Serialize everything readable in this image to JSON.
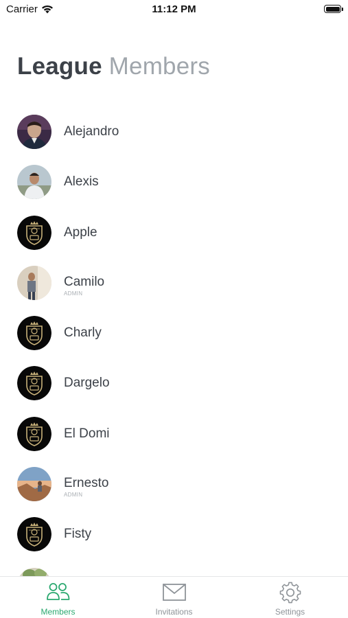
{
  "status_bar": {
    "carrier": "Carrier",
    "time": "11:12 PM"
  },
  "header": {
    "title_strong": "League",
    "title_light": "Members"
  },
  "members": [
    {
      "name": "Alejandro",
      "role": "",
      "avatar": "photo-portrait-dark"
    },
    {
      "name": "Alexis",
      "role": "",
      "avatar": "photo-outdoor"
    },
    {
      "name": "Apple",
      "role": "",
      "avatar": "league-crest-badge"
    },
    {
      "name": "Camilo",
      "role": "ADMIN",
      "avatar": "photo-indoor"
    },
    {
      "name": "Charly",
      "role": "",
      "avatar": "league-crest-badge"
    },
    {
      "name": "Dargelo",
      "role": "",
      "avatar": "league-crest-badge"
    },
    {
      "name": "El Domi",
      "role": "",
      "avatar": "league-crest-badge"
    },
    {
      "name": "Ernesto",
      "role": "ADMIN",
      "avatar": "photo-sunset"
    },
    {
      "name": "Fisty",
      "role": "",
      "avatar": "league-crest-badge"
    },
    {
      "name": "",
      "role": "",
      "avatar": "photo-partial"
    }
  ],
  "tabs": [
    {
      "label": "Members",
      "icon": "members-icon",
      "active": true
    },
    {
      "label": "Invitations",
      "icon": "envelope-icon",
      "active": false
    },
    {
      "label": "Settings",
      "icon": "gear-icon",
      "active": false
    }
  ],
  "colors": {
    "accent": "#2aa86f",
    "text": "#3c4148",
    "muted": "#a0a6ac"
  }
}
